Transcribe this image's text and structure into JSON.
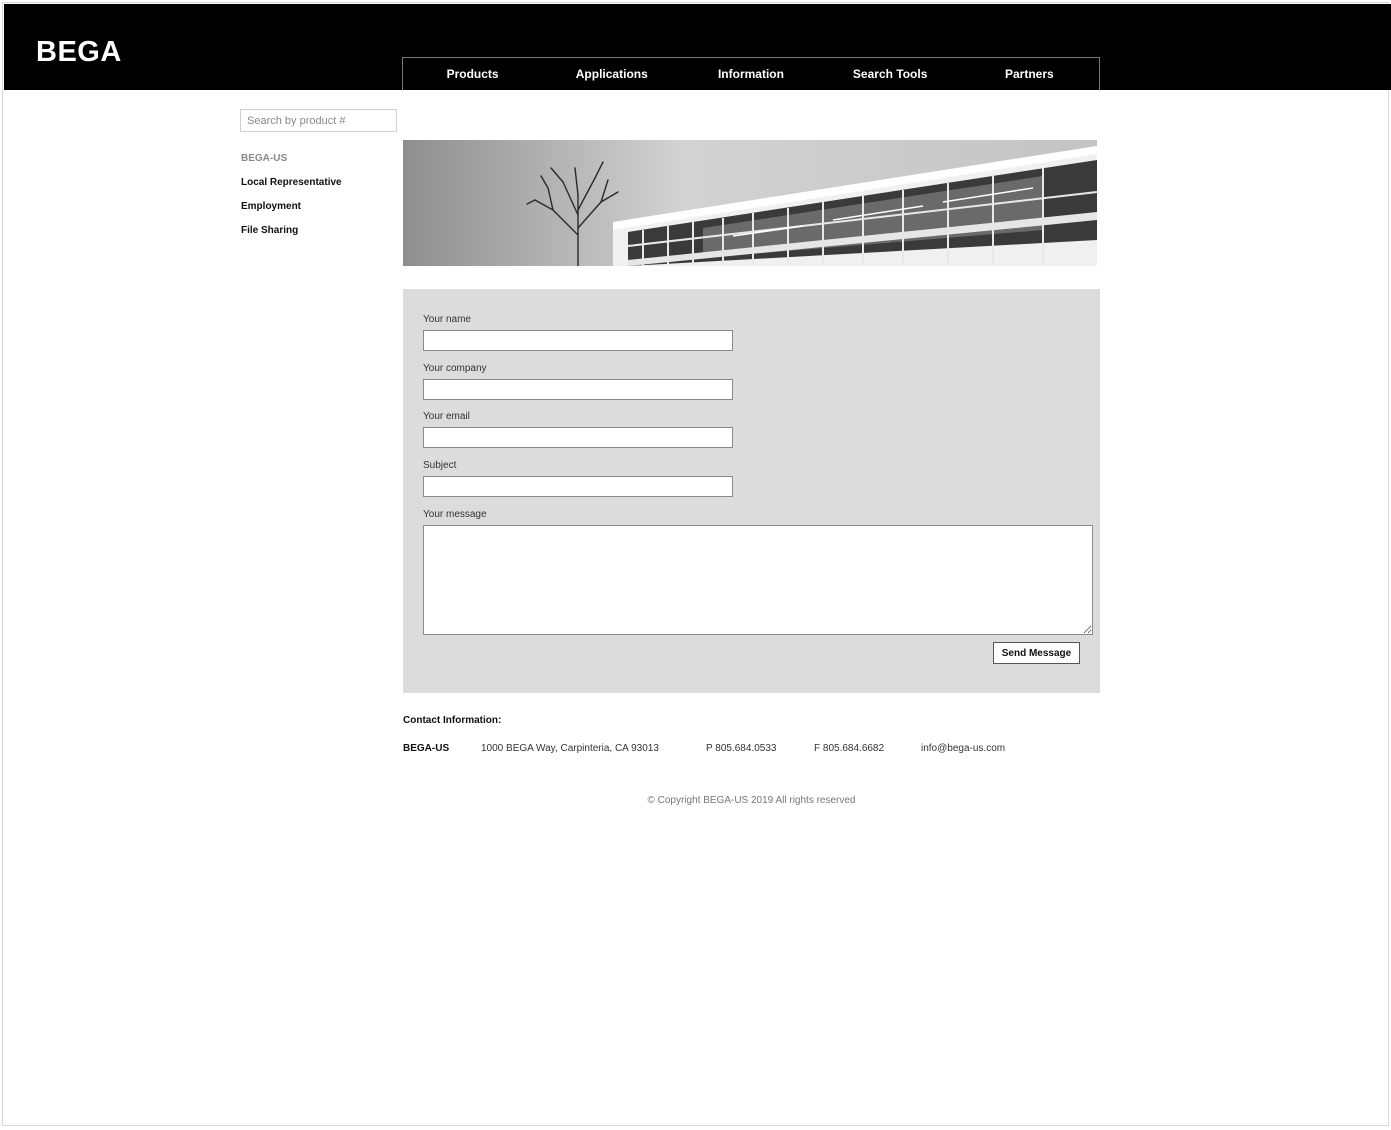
{
  "header": {
    "logo": "BEGA",
    "nav": [
      "Products",
      "Applications",
      "Information",
      "Search Tools",
      "Partners"
    ]
  },
  "sidebar": {
    "search_placeholder": "Search by product #",
    "section": "BEGA-US",
    "links": [
      "Local Representative",
      "Employment",
      "File Sharing"
    ]
  },
  "form": {
    "name_label": "Your name",
    "company_label": "Your company",
    "email_label": "Your email",
    "subject_label": "Subject",
    "message_label": "Your message",
    "send_label": "Send Message"
  },
  "contact": {
    "title": "Contact Information:",
    "company": "BEGA-US",
    "address": "1000 BEGA Way, Carpinteria, CA 93013",
    "phone": "P 805.684.0533",
    "fax": "F 805.684.6682",
    "email": "info@bega-us.com"
  },
  "footer": {
    "copyright": "© Copyright BEGA-US 2019 All rights reserved"
  }
}
